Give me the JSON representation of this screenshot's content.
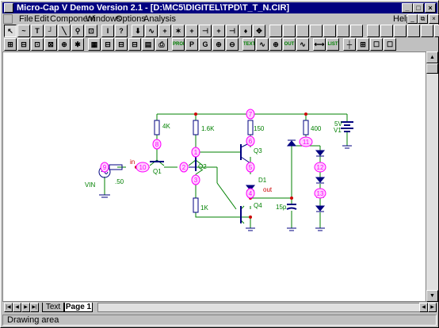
{
  "window": {
    "title": "Micro-Cap V Demo Version 2.1 - [D:\\MC5\\DIGITEL\\TPD\\T_T_N.CIR]"
  },
  "menu": {
    "items": [
      "File",
      "Edit",
      "Component",
      "Windows",
      "Options",
      "Analysis"
    ],
    "help": "Help"
  },
  "toolbar1": [
    "↖",
    "~",
    "T",
    "┘",
    "╲",
    "⚲",
    "⊡",
    "I",
    "?",
    "⬇",
    "∿",
    "+",
    "✶",
    "+",
    "⊣",
    "+",
    "⊣",
    "♦",
    "✥",
    "",
    "",
    "",
    "",
    "",
    "",
    "",
    "",
    "",
    "",
    "",
    "",
    ""
  ],
  "toolbar2": [
    "⊞",
    "⊟",
    "⊡",
    "⊠",
    "⊕",
    "✱",
    "▦",
    "⊟",
    "⊟",
    "⊟",
    "▤",
    "⎙",
    "PROBE",
    "P",
    "G",
    "⊕",
    "⊖",
    "TEXT",
    "∿",
    "⊕",
    "OUT",
    "∿",
    "⟷",
    "LIST",
    "┼",
    "⊞",
    "☐",
    "☐"
  ],
  "schematic": {
    "resistors": [
      "4K",
      "1.6K",
      "150",
      "400",
      "1K"
    ],
    "transistors": [
      "Q1",
      "Q2",
      "Q3",
      "Q4"
    ],
    "diodes": [
      "D1"
    ],
    "capacitor": "15p",
    "battery": {
      "name": "V1",
      "value": "5V"
    },
    "source": {
      "name": "VIN",
      "value": ".50"
    },
    "node_labels": {
      "in": "in",
      "out": "out"
    },
    "nodes": [
      "1",
      "2",
      "3",
      "4",
      "5",
      "6",
      "7",
      "8",
      "9",
      "10",
      "11",
      "12",
      "13"
    ]
  },
  "tabs": {
    "text": "Text",
    "page": "Page 1"
  },
  "status": "Drawing area",
  "colors": {
    "titlebar": "#000080",
    "wire": "#008000",
    "component": "#000080",
    "node_circle": "#ff00ff",
    "node_text": "#ff00ff",
    "label": "#008000",
    "junction": "#cc0000"
  }
}
